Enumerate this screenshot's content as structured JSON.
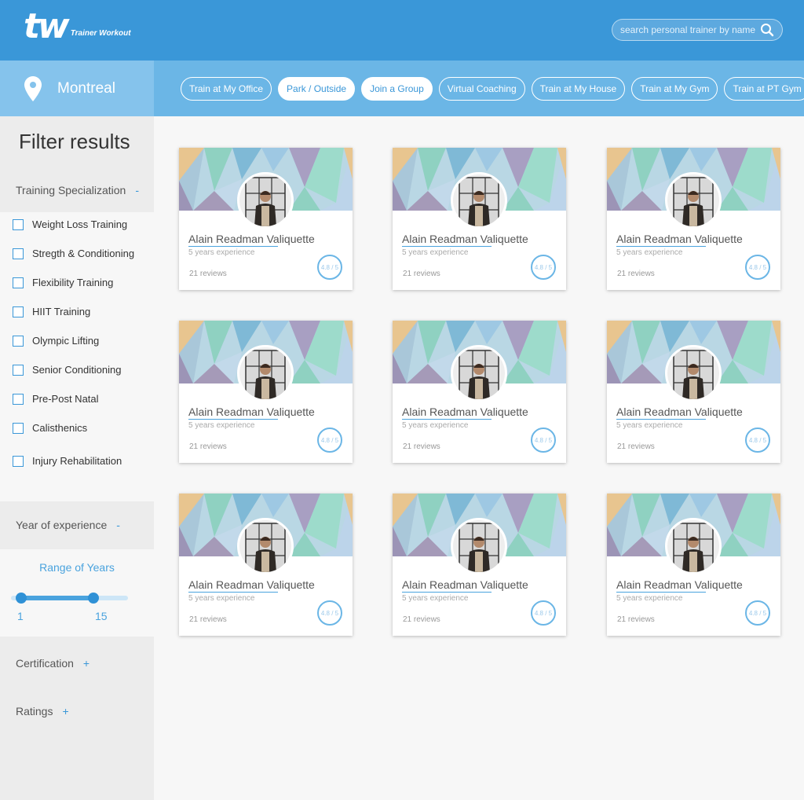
{
  "header": {
    "logo_mark": "tw",
    "logo_text": "Trainer Workout",
    "search_placeholder": "search personal trainer by name"
  },
  "location": {
    "city": "Montreal"
  },
  "chips": [
    {
      "label": "Train at My Office",
      "active": false
    },
    {
      "label": "Park / Outside",
      "active": true
    },
    {
      "label": "Join a Group",
      "active": true
    },
    {
      "label": "Virtual Coaching",
      "active": false
    },
    {
      "label": "Train at My House",
      "active": false
    },
    {
      "label": "Train at My Gym",
      "active": false
    },
    {
      "label": "Train at PT Gym",
      "active": false
    }
  ],
  "sidebar": {
    "title": "Filter results",
    "specialization": {
      "heading": "Training Specialization",
      "toggle": "-",
      "items": [
        "Weight Loss Training",
        "Stregth & Conditioning",
        "Flexibility Training",
        "HIIT Training",
        "Olympic Lifting",
        "Senior Conditioning",
        "Pre-Post Natal",
        "Calisthenics",
        "Injury Rehabilitation"
      ]
    },
    "experience": {
      "heading": "Year of experience",
      "toggle": "-",
      "range_title": "Range of Years",
      "min": "1",
      "max": "15",
      "min_fraction": 0,
      "max_fraction": 0.68
    },
    "certification": {
      "heading": "Certification",
      "toggle": "+"
    },
    "ratings": {
      "heading": "Ratings",
      "toggle": "+"
    }
  },
  "trainers": [
    {
      "name": "Alain Readman Valiquette",
      "experience": "5 years experience",
      "reviews": "21 reviews",
      "rating": "4.8 / 5"
    },
    {
      "name": "Alain Readman Valiquette",
      "experience": "5 years experience",
      "reviews": "21 reviews",
      "rating": "4.8 / 5"
    },
    {
      "name": "Alain Readman Valiquette",
      "experience": "5 years experience",
      "reviews": "21 reviews",
      "rating": "4.8 / 5"
    },
    {
      "name": "Alain Readman Valiquette",
      "experience": "5 years experience",
      "reviews": "21 reviews",
      "rating": "4.8 / 5"
    },
    {
      "name": "Alain Readman Valiquette",
      "experience": "5 years experience",
      "reviews": "21 reviews",
      "rating": "4.8 / 5"
    },
    {
      "name": "Alain Readman Valiquette",
      "experience": "5 years experience",
      "reviews": "21 reviews",
      "rating": "4.8 / 5"
    },
    {
      "name": "Alain Readman Valiquette",
      "experience": "5 years experience",
      "reviews": "21 reviews",
      "rating": "4.8 / 5"
    },
    {
      "name": "Alain Readman Valiquette",
      "experience": "5 years experience",
      "reviews": "21 reviews",
      "rating": "4.8 / 5"
    },
    {
      "name": "Alain Readman Valiquette",
      "experience": "5 years experience",
      "reviews": "21 reviews",
      "rating": "4.8 / 5"
    }
  ],
  "colors": {
    "brand": "#3a97d8",
    "subbar": "#6bb6e6",
    "accent": "#4aa3de"
  }
}
